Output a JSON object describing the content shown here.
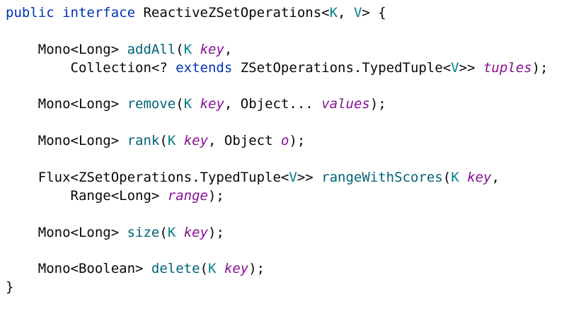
{
  "colors": {
    "background": "#ffffff",
    "keyword": "#0033b3",
    "type_parameter": "#007e8a",
    "method": "#00627a",
    "parameter": "#871094",
    "text": "#080808"
  },
  "code": {
    "lines": [
      [
        {
          "t": "public",
          "k": "kw"
        },
        {
          "t": " ",
          "k": "tx"
        },
        {
          "t": "interface",
          "k": "kw"
        },
        {
          "t": " ReactiveZSetOperations<",
          "k": "tx"
        },
        {
          "t": "K",
          "k": "tp"
        },
        {
          "t": ", ",
          "k": "tx"
        },
        {
          "t": "V",
          "k": "tp"
        },
        {
          "t": "> {",
          "k": "tx"
        }
      ],
      [],
      [
        {
          "t": "    Mono<Long> ",
          "k": "tx"
        },
        {
          "t": "addAll",
          "k": "fn"
        },
        {
          "t": "(",
          "k": "tx"
        },
        {
          "t": "K",
          "k": "tp"
        },
        {
          "t": " ",
          "k": "tx"
        },
        {
          "t": "key",
          "k": "pm"
        },
        {
          "t": ",",
          "k": "tx"
        }
      ],
      [
        {
          "t": "        Collection<? ",
          "k": "tx"
        },
        {
          "t": "extends",
          "k": "kw"
        },
        {
          "t": " ZSetOperations.TypedTuple<",
          "k": "tx"
        },
        {
          "t": "V",
          "k": "tp"
        },
        {
          "t": ">> ",
          "k": "tx"
        },
        {
          "t": "tuples",
          "k": "pm"
        },
        {
          "t": ");",
          "k": "tx"
        }
      ],
      [],
      [
        {
          "t": "    Mono<Long> ",
          "k": "tx"
        },
        {
          "t": "remove",
          "k": "fn"
        },
        {
          "t": "(",
          "k": "tx"
        },
        {
          "t": "K",
          "k": "tp"
        },
        {
          "t": " ",
          "k": "tx"
        },
        {
          "t": "key",
          "k": "pm"
        },
        {
          "t": ", Object... ",
          "k": "tx"
        },
        {
          "t": "values",
          "k": "pm"
        },
        {
          "t": ");",
          "k": "tx"
        }
      ],
      [],
      [
        {
          "t": "    Mono<Long> ",
          "k": "tx"
        },
        {
          "t": "rank",
          "k": "fn"
        },
        {
          "t": "(",
          "k": "tx"
        },
        {
          "t": "K",
          "k": "tp"
        },
        {
          "t": " ",
          "k": "tx"
        },
        {
          "t": "key",
          "k": "pm"
        },
        {
          "t": ", Object ",
          "k": "tx"
        },
        {
          "t": "o",
          "k": "pm"
        },
        {
          "t": ");",
          "k": "tx"
        }
      ],
      [],
      [
        {
          "t": "    Flux<ZSetOperations.TypedTuple<",
          "k": "tx"
        },
        {
          "t": "V",
          "k": "tp"
        },
        {
          "t": ">> ",
          "k": "tx"
        },
        {
          "t": "rangeWithScores",
          "k": "fn"
        },
        {
          "t": "(",
          "k": "tx"
        },
        {
          "t": "K",
          "k": "tp"
        },
        {
          "t": " ",
          "k": "tx"
        },
        {
          "t": "key",
          "k": "pm"
        },
        {
          "t": ",",
          "k": "tx"
        }
      ],
      [
        {
          "t": "        Range<Long> ",
          "k": "tx"
        },
        {
          "t": "range",
          "k": "pm"
        },
        {
          "t": ");",
          "k": "tx"
        }
      ],
      [],
      [
        {
          "t": "    Mono<Long> ",
          "k": "tx"
        },
        {
          "t": "size",
          "k": "fn"
        },
        {
          "t": "(",
          "k": "tx"
        },
        {
          "t": "K",
          "k": "tp"
        },
        {
          "t": " ",
          "k": "tx"
        },
        {
          "t": "key",
          "k": "pm"
        },
        {
          "t": ");",
          "k": "tx"
        }
      ],
      [],
      [
        {
          "t": "    Mono<Boolean> ",
          "k": "tx"
        },
        {
          "t": "delete",
          "k": "fn"
        },
        {
          "t": "(",
          "k": "tx"
        },
        {
          "t": "K",
          "k": "tp"
        },
        {
          "t": " ",
          "k": "tx"
        },
        {
          "t": "key",
          "k": "pm"
        },
        {
          "t": ");",
          "k": "tx"
        }
      ],
      [
        {
          "t": "}",
          "k": "tx"
        }
      ]
    ]
  }
}
